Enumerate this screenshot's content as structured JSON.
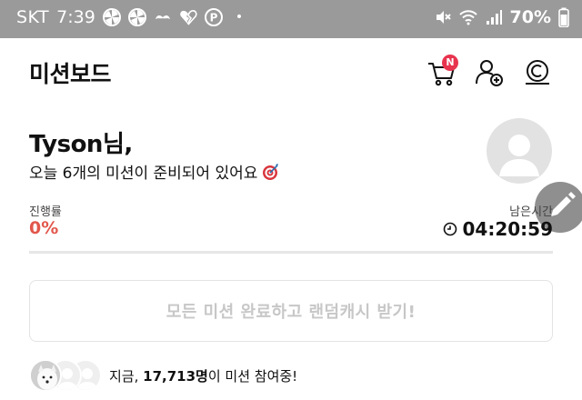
{
  "status_bar": {
    "carrier": "SKT",
    "time": "7:39",
    "battery": "70%",
    "dot": "•"
  },
  "header": {
    "title": "미션보드",
    "cart_badge": "N"
  },
  "greeting": {
    "name": "Tyson님,",
    "message": "오늘 6개의 미션이 준비되어 있어요"
  },
  "progress": {
    "label": "진행률",
    "value": "0%"
  },
  "remaining": {
    "label": "남은시간",
    "value": "04:20:59"
  },
  "reward_button": {
    "label": "모든 미션 완료하고 랜덤캐시 받기!"
  },
  "participants": {
    "prefix": "지금, ",
    "count": "17,713명",
    "suffix": "이 미션 참여중!"
  },
  "colors": {
    "accent": "#e2574c",
    "badge": "#e8344e",
    "statusbar": "#9a9a9a"
  }
}
